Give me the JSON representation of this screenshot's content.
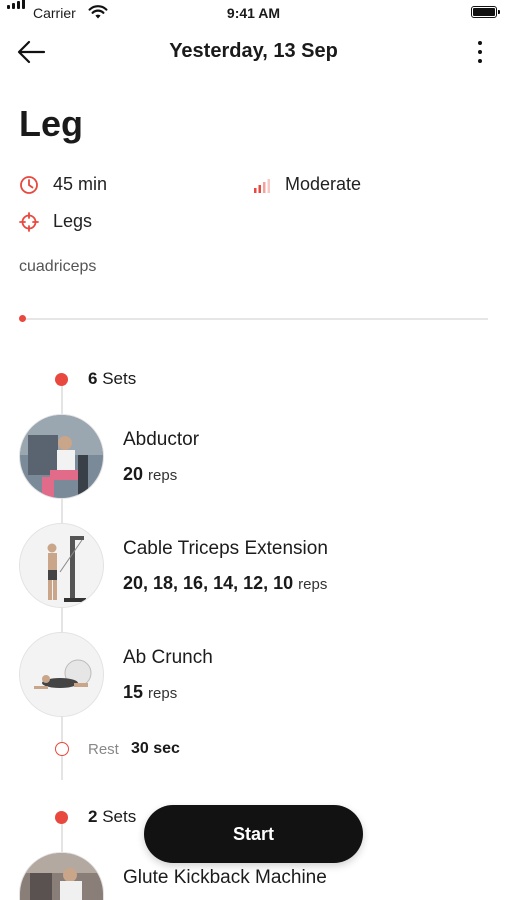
{
  "status_bar": {
    "carrier": "Carrier",
    "time": "9:41 AM"
  },
  "header": {
    "title": "Yesterday, 13 Sep",
    "back_icon": "arrow-left-icon",
    "menu_icon": "more-vertical-icon"
  },
  "workout": {
    "title": "Leg",
    "duration": "45 min",
    "intensity": "Moderate",
    "target": "Legs",
    "tag": "cuadriceps"
  },
  "blocks": [
    {
      "sets_count": "6",
      "sets_label": "Sets",
      "exercises": [
        {
          "name": "Abductor",
          "reps": "20",
          "unit": "reps"
        },
        {
          "name": "Cable Triceps Extension",
          "reps": "20, 18, 16, 14, 12, 10",
          "unit": "reps"
        },
        {
          "name": "Ab Crunch",
          "reps": "15",
          "unit": "reps"
        }
      ],
      "rest_label": "Rest",
      "rest_value": "30 sec"
    },
    {
      "sets_count": "2",
      "sets_label": "Sets",
      "exercises": [
        {
          "name": "Glute Kickback Machine"
        }
      ]
    }
  ],
  "start_button": "Start",
  "colors": {
    "accent": "#e8483e",
    "button": "#121212"
  }
}
